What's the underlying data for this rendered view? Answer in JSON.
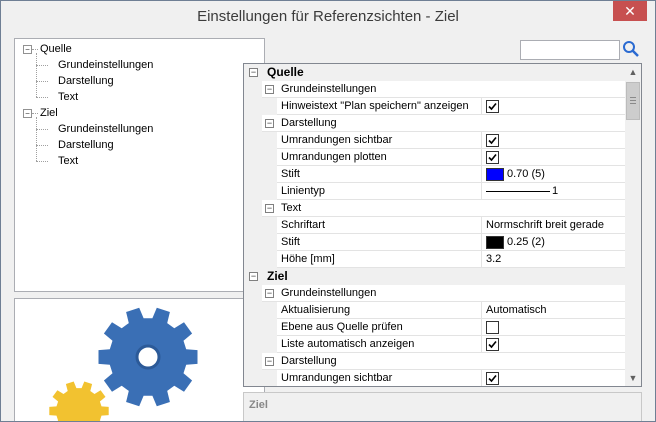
{
  "window": {
    "title": "Einstellungen für Referenzsichten - Ziel",
    "close_glyph": "✕"
  },
  "tree": {
    "nodes": [
      {
        "label": "Quelle",
        "toggle": "−"
      },
      {
        "label": "Grundeinstellungen"
      },
      {
        "label": "Darstellung"
      },
      {
        "label": "Text"
      },
      {
        "label": "Ziel",
        "toggle": "−"
      },
      {
        "label": "Grundeinstellungen"
      },
      {
        "label": "Darstellung"
      },
      {
        "label": "Text"
      }
    ]
  },
  "search": {
    "value": "",
    "icon": "search-icon"
  },
  "grid": {
    "collapse_glyph": "−",
    "rows": [
      {
        "kind": "category",
        "label": "Quelle"
      },
      {
        "kind": "sub",
        "label": "Grundeinstellungen"
      },
      {
        "kind": "prop",
        "name": "Hinweistext \"Plan speichern\" anzeigen",
        "type": "check",
        "checked": true
      },
      {
        "kind": "sub",
        "label": "Darstellung"
      },
      {
        "kind": "prop",
        "name": "Umrandungen sichtbar",
        "type": "check",
        "checked": true
      },
      {
        "kind": "prop",
        "name": "Umrandungen plotten",
        "type": "check",
        "checked": true
      },
      {
        "kind": "prop",
        "name": "Stift",
        "type": "color",
        "color": "#0000ff",
        "value": "0.70 (5)"
      },
      {
        "kind": "prop",
        "name": "Linientyp",
        "type": "line",
        "value": "1"
      },
      {
        "kind": "sub",
        "label": "Text"
      },
      {
        "kind": "prop",
        "name": "Schriftart",
        "type": "text",
        "value": "Normschrift breit gerade"
      },
      {
        "kind": "prop",
        "name": "Stift",
        "type": "color",
        "color": "#000000",
        "value": "0.25 (2)"
      },
      {
        "kind": "prop",
        "name": "Höhe [mm]",
        "type": "text",
        "value": "3.2"
      },
      {
        "kind": "category",
        "label": "Ziel"
      },
      {
        "kind": "sub",
        "label": "Grundeinstellungen"
      },
      {
        "kind": "prop",
        "name": "Aktualisierung",
        "type": "text",
        "value": "Automatisch"
      },
      {
        "kind": "prop",
        "name": "Ebene aus Quelle prüfen",
        "type": "check",
        "checked": false
      },
      {
        "kind": "prop",
        "name": "Liste automatisch anzeigen",
        "type": "check",
        "checked": true
      },
      {
        "kind": "sub",
        "label": "Darstellung"
      },
      {
        "kind": "prop",
        "name": "Umrandungen sichtbar",
        "type": "check",
        "checked": true
      }
    ]
  },
  "scrollbar": {
    "up_glyph": "▲",
    "down_glyph": "▼"
  },
  "description": {
    "title": "Ziel"
  },
  "colors": {
    "gear_blue": "#3a6fb5",
    "gear_yellow": "#f2c230"
  }
}
